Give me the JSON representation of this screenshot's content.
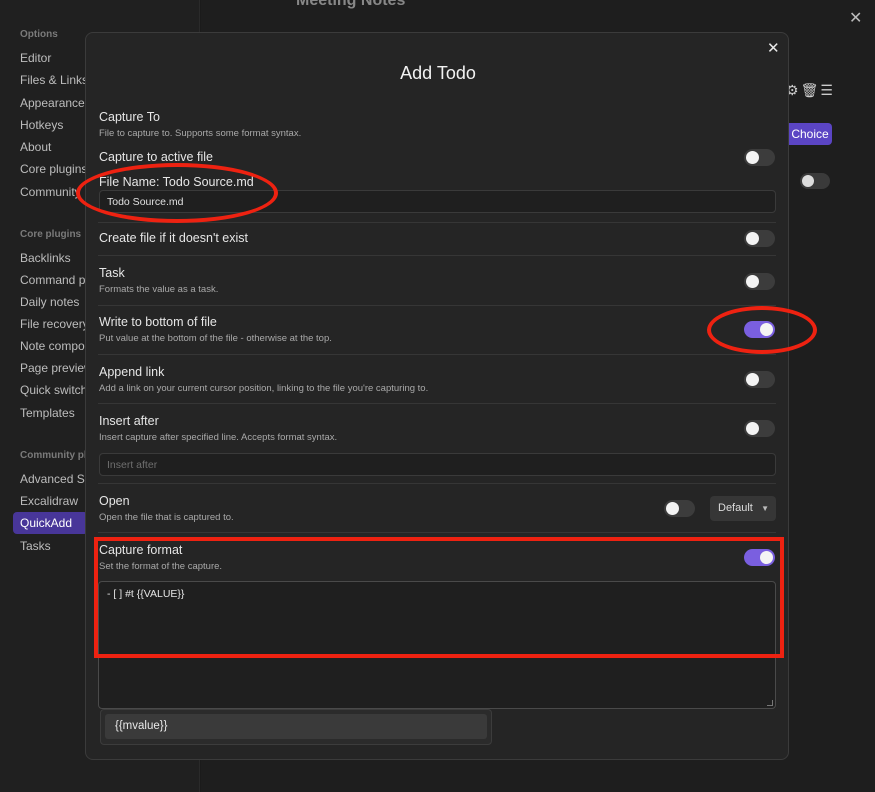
{
  "background": {
    "sidebar": {
      "options_heading": "Options",
      "options": [
        "Editor",
        "Files & Links",
        "Appearance",
        "Hotkeys",
        "About",
        "Core plugins",
        "Community"
      ],
      "core_heading": "Core plugins",
      "core_items": [
        "Backlinks",
        "Command pa",
        "Daily notes",
        "File recovery",
        "Note compos",
        "Page preview",
        "Quick switch",
        "Templates"
      ],
      "community_heading": "Community pl",
      "community_items": [
        "Advanced Sli",
        "Excalidraw",
        "QuickAdd",
        "Tasks"
      ],
      "active_item": "QuickAdd"
    },
    "main_title": "Meeting Notes",
    "choice_button": "Choice",
    "icons": [
      "gear-icon",
      "trash-icon",
      "menu-icon"
    ]
  },
  "modal": {
    "title": "Add Todo",
    "capture_to": {
      "label": "Capture To",
      "desc": "File to capture to. Supports some format syntax."
    },
    "capture_active": {
      "label": "Capture to active file",
      "enabled": false
    },
    "file_name": {
      "label": "File Name: Todo Source.md",
      "value": "Todo Source.md"
    },
    "create_file": {
      "label": "Create file if it doesn't exist",
      "enabled": false
    },
    "task": {
      "label": "Task",
      "desc": "Formats the value as a task.",
      "enabled": false
    },
    "write_bottom": {
      "label": "Write to bottom of file",
      "desc": "Put value at the bottom of the file - otherwise at the top.",
      "enabled": true
    },
    "append_link": {
      "label": "Append link",
      "desc": "Add a link on your current cursor position, linking to the file you're capturing to.",
      "enabled": false
    },
    "insert_after": {
      "label": "Insert after",
      "desc": "Insert capture after specified line. Accepts format syntax.",
      "enabled": false,
      "placeholder": "Insert after"
    },
    "open": {
      "label": "Open",
      "desc": "Open the file that is captured to.",
      "enabled": false,
      "dropdown_value": "Default"
    },
    "capture_format": {
      "label": "Capture format",
      "desc": "Set the format of the capture.",
      "enabled": true,
      "value": "- [ ] #t {{VALUE}}"
    },
    "suggestion": "{{mvalue}}"
  },
  "colors": {
    "accent": "#7a5fe0",
    "annotation": "#ee2211"
  }
}
